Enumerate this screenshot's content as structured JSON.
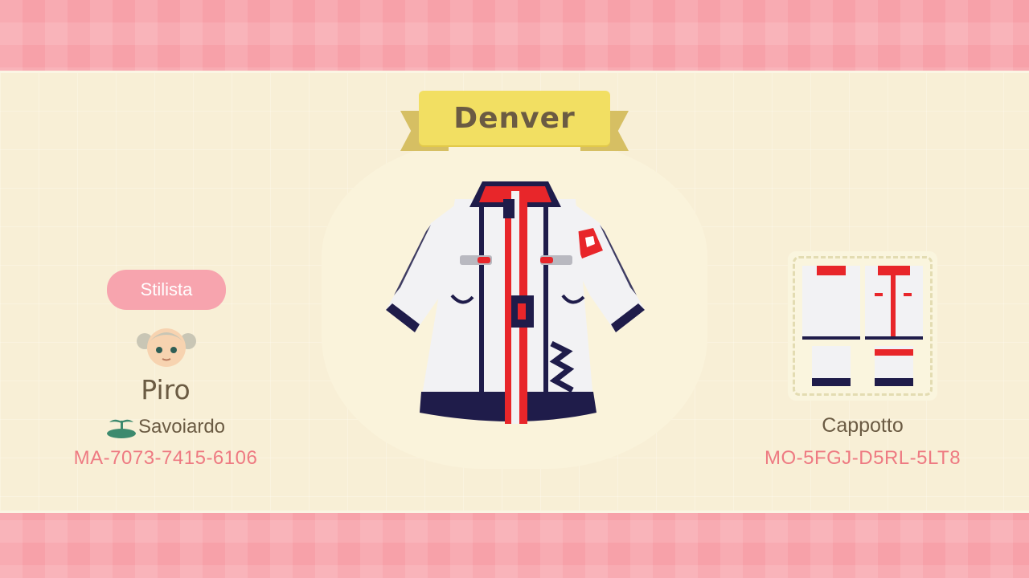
{
  "design": {
    "title": "Denver"
  },
  "creator": {
    "role_label": "Stilista",
    "name": "Piro",
    "island_icon": "island-palm-icon",
    "island_name": "Savoiardo",
    "code": "MA-7073-7415-6106"
  },
  "item": {
    "type": "Cappotto",
    "code": "MO-5FGJ-D5RL-5LT8"
  },
  "colors": {
    "border_pink": "#f7a1a9",
    "panel_cream": "#f8efd6",
    "ribbon_yellow": "#f2df62",
    "text_brown": "#6b5b43",
    "code_pink": "#ee7a82",
    "coat_white": "#f2f2f4",
    "coat_red": "#e8262a",
    "coat_navy": "#1f1c4a"
  }
}
